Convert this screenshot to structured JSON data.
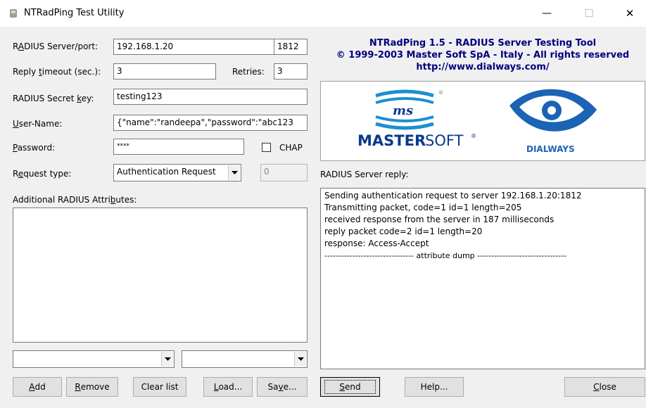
{
  "window": {
    "title": "NTRadPing Test Utility",
    "minimize_glyph": "—",
    "maximize_glyph": "☐",
    "close_glyph": "✕"
  },
  "form": {
    "server_label_pre": "R",
    "server_label_ul": "A",
    "server_label_post": "DIUS Server/port:",
    "server_value": "192.168.1.20",
    "port_value": "1812",
    "timeout_label_pre": "Reply ",
    "timeout_label_ul": "t",
    "timeout_label_post": "imeout (sec.):",
    "timeout_value": "3",
    "retries_label": "Retries:",
    "retries_value": "3",
    "secret_label_pre": "RADIUS Secret ",
    "secret_label_ul": "k",
    "secret_label_post": "ey:",
    "secret_value": "testing123",
    "username_label_ul": "U",
    "username_label_post": "ser-Name:",
    "username_value": "{\"name\":\"randeepa\",\"password\":\"abc123",
    "password_label_ul": "P",
    "password_label_post": "assword:",
    "password_value": "****",
    "chap_label": "CHAP",
    "chap_checked": false,
    "request_label_pre": "R",
    "request_label_ul": "e",
    "request_label_post": "quest type:",
    "request_value": "Authentication Request",
    "id_value": "0",
    "attributes_label_pre": "Additional RADIUS Attri",
    "attributes_label_ul": "b",
    "attributes_label_post": "utes:",
    "attr_combo1_value": "",
    "attr_combo2_value": ""
  },
  "buttons": {
    "add_ul": "A",
    "add_post": "dd",
    "remove_ul": "R",
    "remove_post": "emove",
    "clear": "Clear list",
    "load_ul": "L",
    "load_post": "oad...",
    "save_pre": "Sa",
    "save_ul": "v",
    "save_post": "e...",
    "send_ul": "S",
    "send_post": "end",
    "help": "Help...",
    "close_ul": "C",
    "close_post": "lose"
  },
  "header": {
    "line1": "NTRadPing 1.5 - RADIUS Server Testing Tool",
    "line2": "© 1999-2003 Master Soft SpA - Italy - All rights reserved",
    "line3": "http://www.dialways.com/"
  },
  "logos": {
    "ms_badge": "ms",
    "mastersoft_bold": "MASTER",
    "mastersoft_light": "SOFT",
    "mastersoft_reg": "®",
    "ms_reg": "®",
    "dialways": "DIALWAYS",
    "mastersoft_blue": "#0a3a8c",
    "dialways_blue": "#1b63b4"
  },
  "reply": {
    "label": "RADIUS Server reply:",
    "lines": [
      "Sending authentication request to server 192.168.1.20:1812",
      "Transmitting packet, code=1 id=1 length=205",
      "received response from the server in 187 milliseconds",
      "reply packet code=2 id=1 length=20",
      "response: Access-Accept",
      "-------------------------------- attribute dump --------------------------------"
    ]
  }
}
